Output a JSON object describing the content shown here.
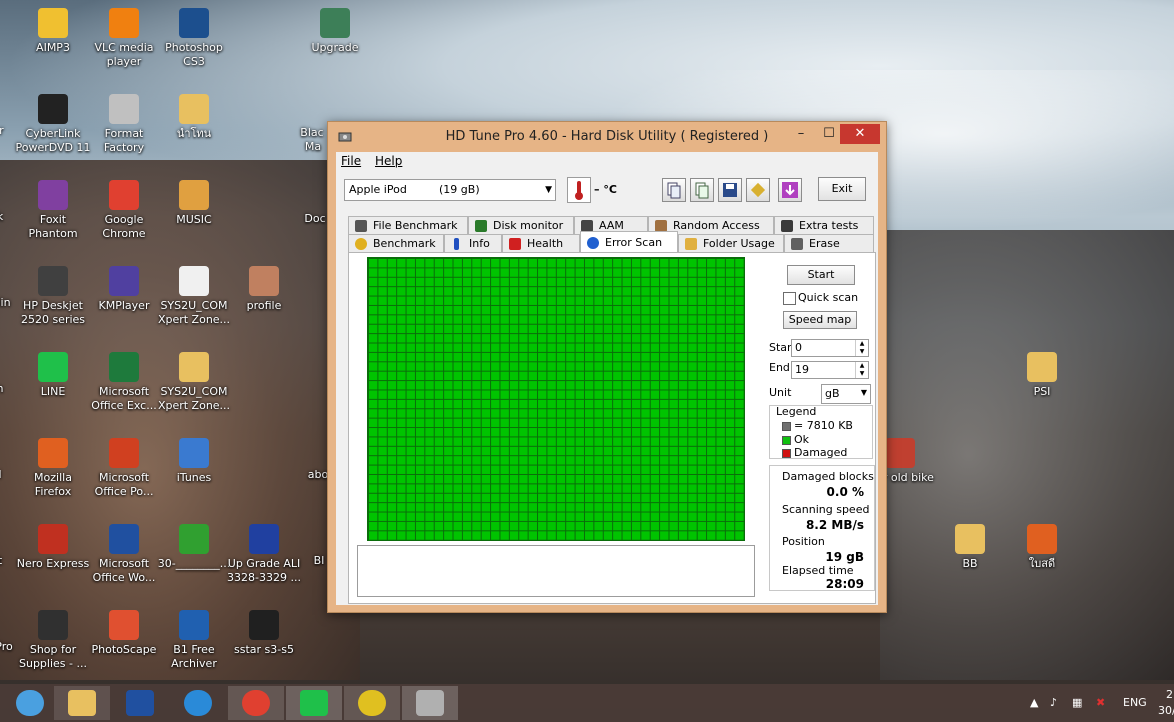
{
  "desktop": {
    "icons": [
      {
        "id": "aimp3",
        "label": "AIMP3",
        "color": "#f0c030"
      },
      {
        "id": "vlc",
        "label": "VLC media player",
        "color": "#f08010"
      },
      {
        "id": "photoshop",
        "label": "Photoshop CS3",
        "color": "#1c4f8e"
      },
      {
        "id": "upgrade",
        "label": "Upgrade",
        "color": "#3d7f58"
      },
      {
        "id": "cyberlink",
        "label": "CyberLink PowerDVD 11",
        "color": "#222"
      },
      {
        "id": "formatfactory",
        "label": "Format Factory",
        "color": "#c0c0c0"
      },
      {
        "id": "folder-thai",
        "label": "นำโทน",
        "color": "#e8c060"
      },
      {
        "id": "foxit",
        "label": "Foxit Phantom",
        "color": "#8040a0"
      },
      {
        "id": "chrome",
        "label": "Google Chrome",
        "color": "#e04030"
      },
      {
        "id": "music",
        "label": "MUSIC",
        "color": "#e0a040"
      },
      {
        "id": "hpdeskjet",
        "label": "HP Deskjet 2520 series",
        "color": "#404040"
      },
      {
        "id": "kmplayer",
        "label": "KMPlayer",
        "color": "#5040a0"
      },
      {
        "id": "sys2u1",
        "label": "SYS2U_COM Xpert Zone...",
        "color": "#f0f0f0"
      },
      {
        "id": "profile",
        "label": "profile",
        "color": "#c08060"
      },
      {
        "id": "line",
        "label": "LINE",
        "color": "#1fc04a"
      },
      {
        "id": "excel",
        "label": "Microsoft Office Exc...",
        "color": "#1e7a3c"
      },
      {
        "id": "sys2u2",
        "label": "SYS2U_COM Xpert Zone...",
        "color": "#e8c060"
      },
      {
        "id": "firefox",
        "label": "Mozilla Firefox",
        "color": "#e06020"
      },
      {
        "id": "powerpoint",
        "label": "Microsoft Office Po...",
        "color": "#d04020"
      },
      {
        "id": "itunes",
        "label": "iTunes",
        "color": "#3a7ad0"
      },
      {
        "id": "nero",
        "label": "Nero Express",
        "color": "#c03020"
      },
      {
        "id": "word",
        "label": "Microsoft Office Wo...",
        "color": "#2050a0"
      },
      {
        "id": "thirty",
        "label": "30-________...",
        "color": "#30a030"
      },
      {
        "id": "upgradeali",
        "label": "Up Grade ALI 3328-3329 ...",
        "color": "#2040a0"
      },
      {
        "id": "shopfor",
        "label": "Shop for Supplies - ...",
        "color": "#303030"
      },
      {
        "id": "photoscape",
        "label": "PhotoScape",
        "color": "#e05030"
      },
      {
        "id": "b1",
        "label": "B1 Free Archiver",
        "color": "#2060b0"
      },
      {
        "id": "sstar",
        "label": "sstar s3-s5",
        "color": "#202020"
      },
      {
        "id": "psi",
        "label": "PSI",
        "color": "#e8c060"
      },
      {
        "id": "pairoldbike",
        "label": "pair old bike",
        "color": "#c04030"
      },
      {
        "id": "bb",
        "label": "BB",
        "color": "#e8c060"
      },
      {
        "id": "thaifolder",
        "label": "ใบสดี",
        "color": "#e06020"
      }
    ],
    "partial_labels": {
      "er": "er",
      "k": "k",
      "lin": "lin",
      "n": "n",
      "l": "l",
      "t": "t",
      "pro": "Pro",
      "blac": "Blac",
      "ma": "Ma",
      "doc": "Doc",
      "abo": "abo",
      "bi": "BI"
    }
  },
  "window": {
    "title": "HD Tune Pro 4.60 - Hard Disk Utility ( Registered )",
    "controls": {
      "minimize": "–",
      "maximize": "☐",
      "close": "✕"
    },
    "menu": {
      "file": "File",
      "help": "Help"
    },
    "drive": {
      "name": "Apple iPod",
      "size": "(19 gB)"
    },
    "temperature": "– °C",
    "exit_label": "Exit",
    "tabs_row1": [
      {
        "id": "file-benchmark",
        "label": "File Benchmark",
        "color": "#555"
      },
      {
        "id": "disk-monitor",
        "label": "Disk monitor",
        "color": "#2a7a2a"
      },
      {
        "id": "aam",
        "label": "AAM",
        "color": "#444"
      },
      {
        "id": "random-access",
        "label": "Random Access",
        "color": "#a07040"
      },
      {
        "id": "extra-tests",
        "label": "Extra tests",
        "color": "#3a3a3a"
      }
    ],
    "tabs_row2": [
      {
        "id": "benchmark",
        "label": "Benchmark",
        "color": "#e0b020"
      },
      {
        "id": "info",
        "label": "Info",
        "color": "#2050c0"
      },
      {
        "id": "health",
        "label": "Health",
        "color": "#d02020"
      },
      {
        "id": "error-scan",
        "label": "Error Scan",
        "color": "#2060d0"
      },
      {
        "id": "folder-usage",
        "label": "Folder Usage",
        "color": "#e0b040"
      },
      {
        "id": "erase",
        "label": "Erase",
        "color": "#606060"
      }
    ],
    "active_tab": "error-scan",
    "side": {
      "start_button": "Start",
      "quick_scan": "Quick scan",
      "speed_map": "Speed map",
      "start_label": "Start",
      "start_value": "0",
      "end_label": "End",
      "end_value": "19",
      "unit_label": "Unit",
      "unit_value": "gB",
      "legend_title": "Legend",
      "legend_items": [
        {
          "label": "= 7810 KB",
          "color": "#707070"
        },
        {
          "label": "Ok",
          "color": "#10c010"
        },
        {
          "label": "Damaged",
          "color": "#d01010"
        }
      ],
      "damaged_blocks_label": "Damaged blocks",
      "damaged_blocks_value": "0.0 %",
      "scanning_speed_label": "Scanning speed",
      "scanning_speed_value": "8.2 MB/s",
      "position_label": "Position",
      "position_value": "19 gB",
      "elapsed_label": "Elapsed time",
      "elapsed_value": "28:09"
    },
    "scan_progress_fraction": 1.0,
    "block_status": "all ok"
  },
  "taskbar": {
    "items": [
      {
        "id": "start",
        "color": "#4aa0e0"
      },
      {
        "id": "explorer",
        "color": "#e8c060"
      },
      {
        "id": "word",
        "color": "#2050a0"
      },
      {
        "id": "ie",
        "color": "#2a8ad8"
      },
      {
        "id": "chrome",
        "color": "#e04030"
      },
      {
        "id": "line",
        "color": "#1fc04a"
      },
      {
        "id": "dvd",
        "color": "#e0c020"
      },
      {
        "id": "hdtune",
        "color": "#b0b0b0"
      }
    ],
    "tray": {
      "lang": "ENG",
      "time_partial": "2",
      "date_partial": "30/"
    }
  }
}
